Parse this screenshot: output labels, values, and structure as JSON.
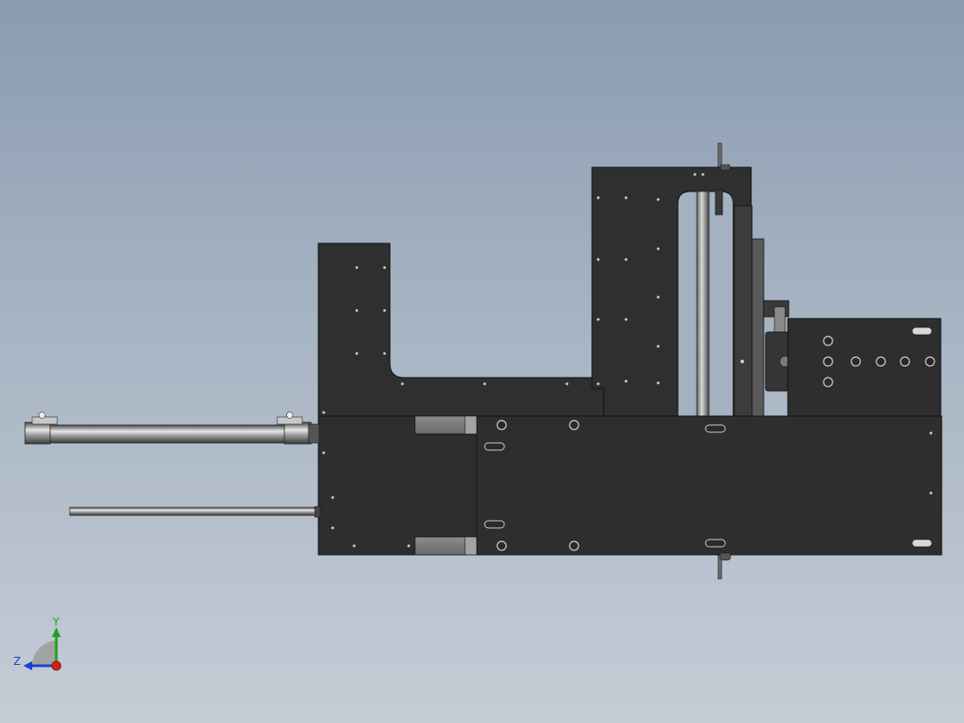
{
  "viewport": {
    "background_top": "#8a9bb0",
    "background_bottom": "#c5ccd6",
    "part_color": "#2e2e2e",
    "part_edge": "#111111"
  },
  "triad": {
    "x_axis": {
      "label": "",
      "color": "#d41f1f"
    },
    "y_axis": {
      "label": "Y",
      "color": "#1fa31f"
    },
    "z_axis": {
      "label": "Z",
      "color": "#1f3fd4"
    }
  }
}
